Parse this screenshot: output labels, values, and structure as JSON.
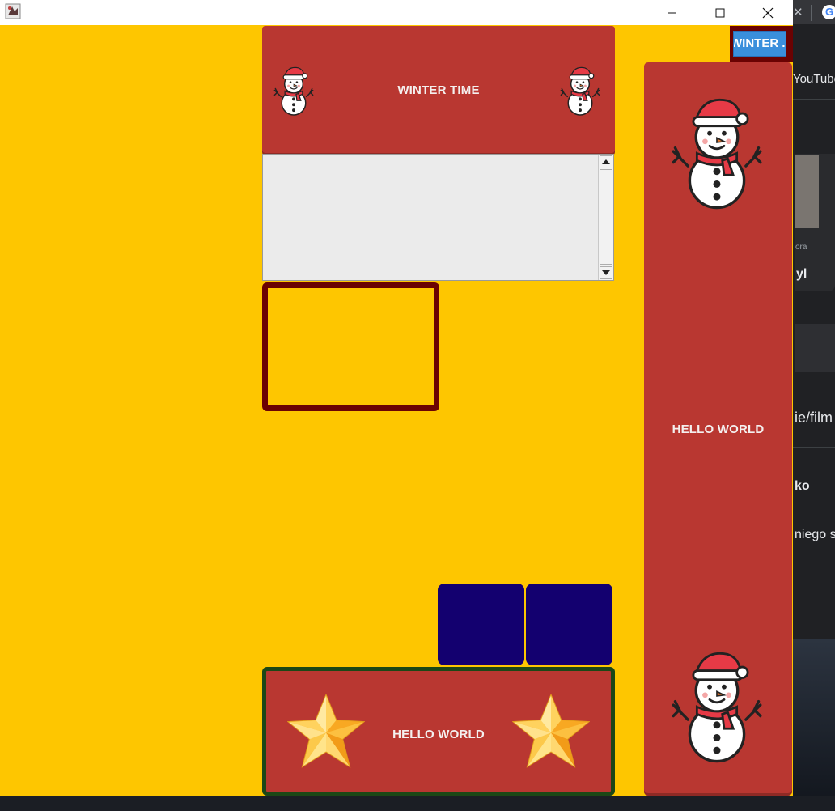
{
  "window": {
    "minimize_glyph": "─",
    "maximize_glyph": "☐",
    "close_glyph": "✕"
  },
  "top_panel": {
    "label": "WINTER TIME",
    "left_icon": "snowman-icon",
    "right_icon": "snowman-icon"
  },
  "textarea": {
    "value": ""
  },
  "bottom_panel": {
    "label": "HELLO WORLD",
    "left_icon": "star-icon",
    "right_icon": "star-icon"
  },
  "right_panel": {
    "label": "HELLO WORLD",
    "top_icon": "snowman-icon",
    "bottom_icon": "snowman-icon"
  },
  "corner_button": {
    "label": "WINTER ..."
  },
  "background_browser": {
    "youtube_text": "YouTube",
    "url_fragment": "ie/film",
    "card_text_1": "ora",
    "card_text_2": "yl",
    "section_text": "ko",
    "body_text": "niego se"
  },
  "colors": {
    "background": "#fec600",
    "panel_red": "#b93731",
    "dark_red_border": "#6b0202",
    "navy_button": "#13006f",
    "green_border": "#1c4716",
    "corner_button_blue": "#3a8fdc"
  }
}
